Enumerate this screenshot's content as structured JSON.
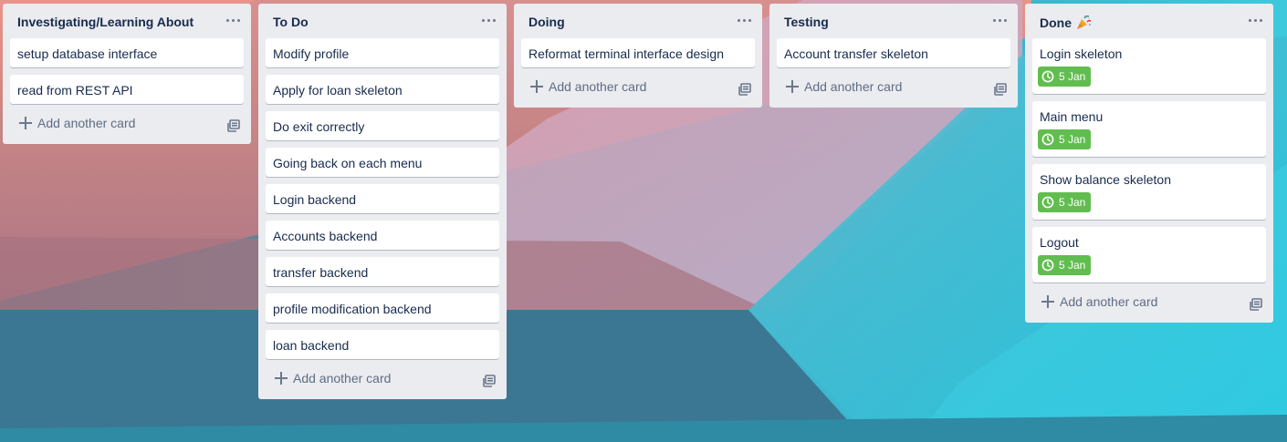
{
  "colors": {
    "list_bg": "#ebecf0",
    "card_bg": "#ffffff",
    "text": "#172b4d",
    "muted": "#5e6c84",
    "due_badge": "#61bd4f"
  },
  "lists": [
    {
      "title": "Investigating/Learning About",
      "cards": [
        {
          "title": "setup database interface"
        },
        {
          "title": "read from REST API"
        }
      ],
      "add_label": "Add another card"
    },
    {
      "title": "To Do",
      "cards": [
        {
          "title": "Modify profile"
        },
        {
          "title": "Apply for loan skeleton"
        },
        {
          "title": "Do exit correctly"
        },
        {
          "title": "Going back on each menu"
        },
        {
          "title": "Login backend"
        },
        {
          "title": "Accounts backend"
        },
        {
          "title": "transfer backend"
        },
        {
          "title": "profile modification backend"
        },
        {
          "title": "loan backend"
        }
      ],
      "add_label": "Add another card"
    },
    {
      "title": "Doing",
      "cards": [
        {
          "title": "Reformat terminal interface design"
        }
      ],
      "add_label": "Add another card"
    },
    {
      "title": "Testing",
      "cards": [
        {
          "title": "Account transfer skeleton"
        }
      ],
      "add_label": "Add another card"
    },
    {
      "title": "Done",
      "title_emoji": "party-popper-icon",
      "cards": [
        {
          "title": "Login skeleton",
          "due": "5 Jan"
        },
        {
          "title": "Main menu",
          "due": "5 Jan"
        },
        {
          "title": "Show balance skeleton",
          "due": "5 Jan"
        },
        {
          "title": "Logout",
          "due": "5 Jan"
        }
      ],
      "add_label": "Add another card"
    }
  ],
  "icons": {
    "list_menu": "ellipsis-icon",
    "add": "plus-icon",
    "template": "card-template-icon",
    "due": "clock-icon"
  }
}
